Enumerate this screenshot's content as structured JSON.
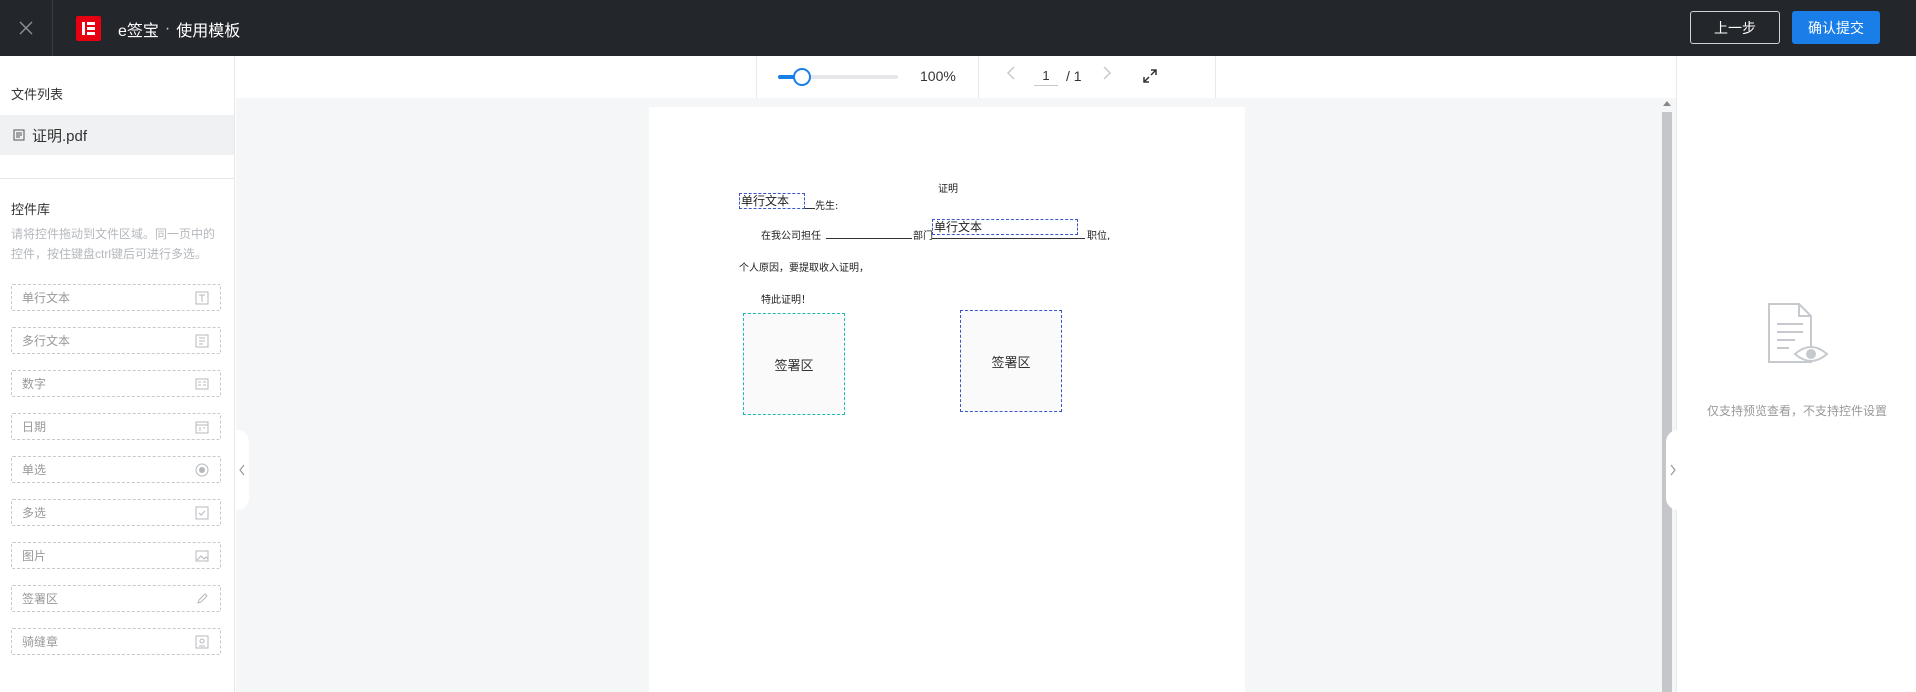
{
  "header": {
    "brand": "e签宝",
    "separator": "·",
    "title": "使用模板",
    "prev_label": "上一步",
    "submit_label": "确认提交",
    "accent_color": "#1a7ee8",
    "logo_color": "#e60012"
  },
  "sidebar": {
    "file_list_title": "文件列表",
    "file_name": "证明.pdf",
    "controls_title": "控件库",
    "hint": "请将控件拖动到文件区域。同一页中的控件，按住键盘ctrl键后可进行多选。",
    "controls": [
      {
        "label": "单行文本",
        "icon": "single-line-text-icon"
      },
      {
        "label": "多行文本",
        "icon": "multi-line-text-icon"
      },
      {
        "label": "数字",
        "icon": "number-icon"
      },
      {
        "label": "日期",
        "icon": "calendar-icon"
      },
      {
        "label": "单选",
        "icon": "radio-icon"
      },
      {
        "label": "多选",
        "icon": "checkbox-icon"
      },
      {
        "label": "图片",
        "icon": "image-icon"
      },
      {
        "label": "签署区",
        "icon": "pen-icon"
      },
      {
        "label": "骑缝章",
        "icon": "seal-icon"
      }
    ]
  },
  "toolbar": {
    "zoom": "100%",
    "zoom_fraction": 0.2,
    "page_current": "1",
    "page_total": "/ 1"
  },
  "document": {
    "heading": "证明",
    "line1_suffix": "先生:",
    "line2_prefix": "在我公司担任",
    "line2_mid": "部门",
    "line2_suffix": "职位,",
    "line3": "个人原因，要提取收入证明，",
    "line4": "特此证明！",
    "field1_label": "单行文本",
    "field2_label": "单行文本",
    "sig1_label": "签署区",
    "sig2_label": "签署区"
  },
  "right_panel": {
    "message": "仅支持预览查看，不支持控件设置"
  }
}
